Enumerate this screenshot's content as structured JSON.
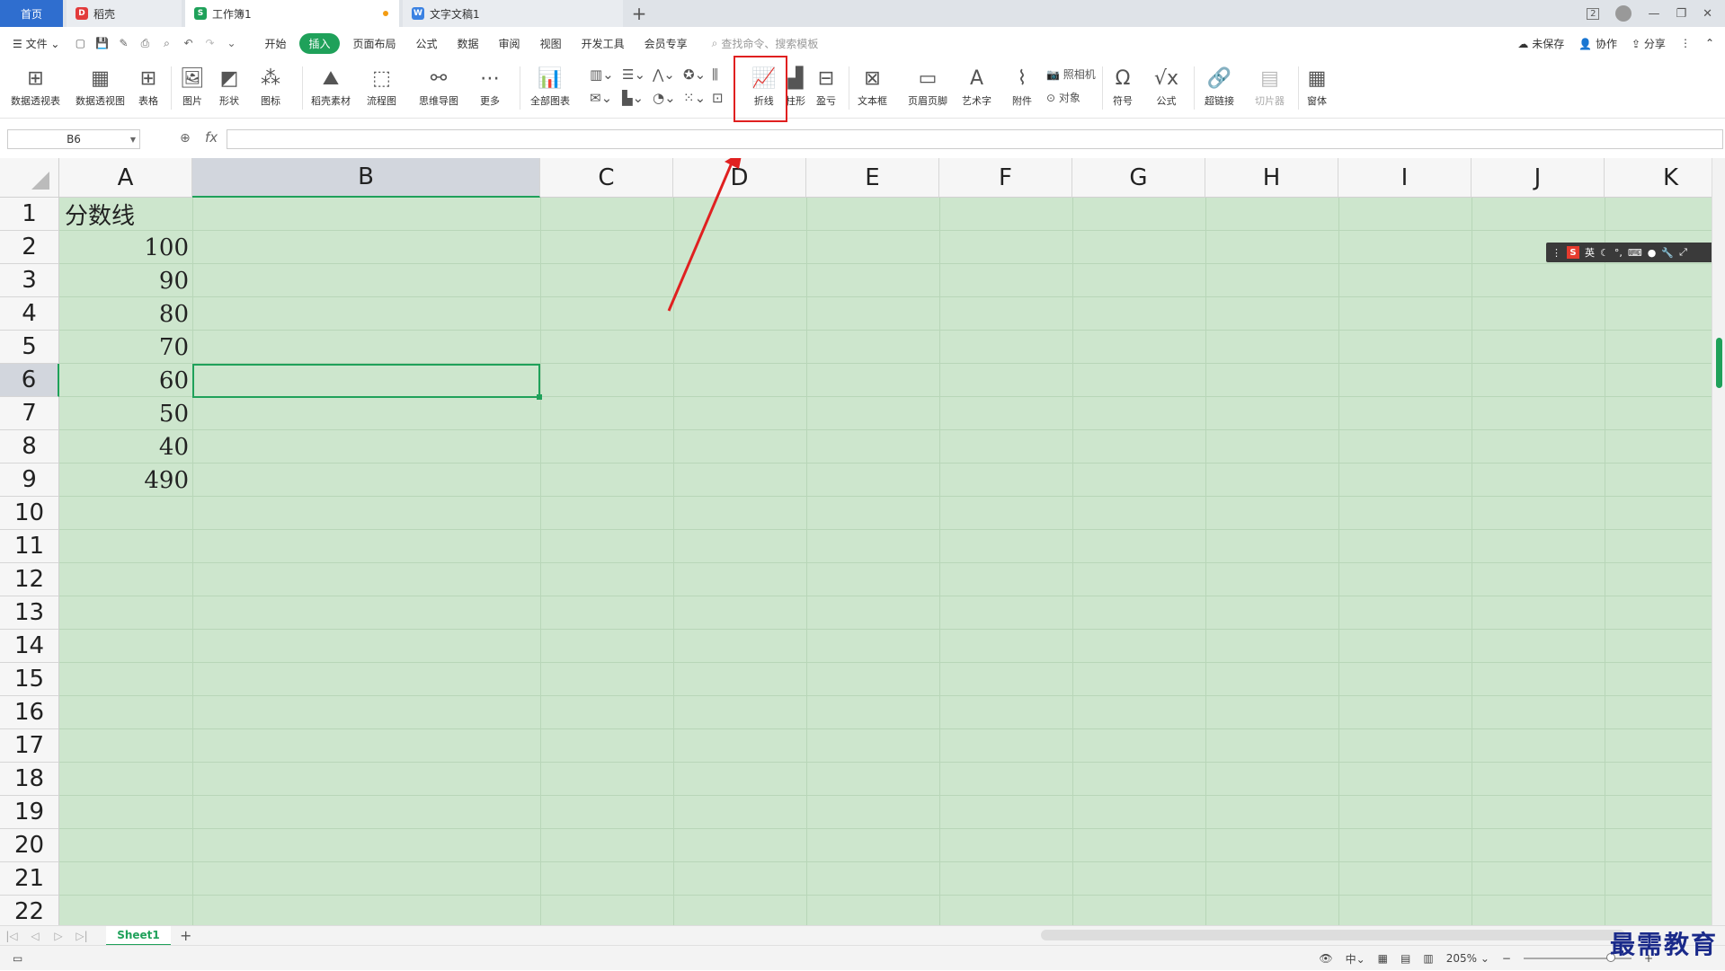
{
  "tabs": {
    "home": "首页",
    "tab1": "稻壳",
    "tab2": "工作簿1",
    "tab3": "文字文稿1",
    "new_tab": "+"
  },
  "window": {
    "badge": "2"
  },
  "menu": {
    "file": "文件",
    "items": [
      "开始",
      "插入",
      "页面布局",
      "公式",
      "数据",
      "审阅",
      "视图",
      "开发工具",
      "会员专享"
    ],
    "active_index": 1,
    "search_placeholder": "查找命令、搜索模板",
    "unsaved": "未保存",
    "collab": "协作",
    "share": "分享"
  },
  "ribbon": {
    "pivot_table": "数据透视表",
    "pivot_chart": "数据透视图",
    "table": "表格",
    "picture": "图片",
    "shape": "形状",
    "icon": "图标",
    "docer_material": "稻壳素材",
    "flowchart": "流程图",
    "mindmap": "思维导图",
    "more": "更多",
    "all_charts": "全部图表",
    "line": "折线",
    "column": "柱形",
    "winloss": "盈亏",
    "textbox": "文本框",
    "header_footer": "页眉页脚",
    "wordart": "艺术字",
    "attachment": "附件",
    "camera": "照相机",
    "object": "对象",
    "symbol": "符号",
    "formula": "公式",
    "hyperlink": "超链接",
    "slicer": "切片器",
    "window": "窗体"
  },
  "formula_bar": {
    "name_box": "B6",
    "fx": "fx",
    "value": ""
  },
  "columns": [
    "A",
    "B",
    "C",
    "D",
    "E",
    "F",
    "G",
    "H",
    "I",
    "J",
    "K"
  ],
  "rows": [
    "1",
    "2",
    "3",
    "4",
    "5",
    "6",
    "7",
    "8",
    "9",
    "10",
    "11",
    "12",
    "13",
    "14",
    "15",
    "16",
    "17",
    "18",
    "19",
    "20",
    "21",
    "22"
  ],
  "cells": {
    "A1": "分数线",
    "A2": "100",
    "A3": "90",
    "A4": "80",
    "A5": "70",
    "A6": "60",
    "A7": "50",
    "A8": "40",
    "A9": "490"
  },
  "selected": {
    "cell": "B6",
    "column": "B",
    "row": "6"
  },
  "ime": {
    "logo": "S",
    "mode": "英"
  },
  "sheets": {
    "active": "Sheet1",
    "add": "+"
  },
  "status": {
    "zoom": "205%"
  },
  "watermark": "最需教育",
  "colors": {
    "accent": "#1fa15a",
    "grid_bg": "#cde6cd",
    "highlight": "#e02020",
    "home_tab": "#2f6ecf"
  }
}
